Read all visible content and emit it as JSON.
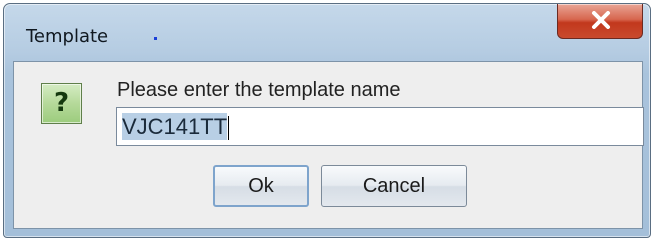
{
  "window": {
    "title": "Template"
  },
  "titlebar": {
    "close_icon": "close-x-icon"
  },
  "dialog": {
    "icon": "question-icon",
    "icon_glyph": "?",
    "prompt": "Please enter the template name",
    "input_value": "VJC141TT",
    "buttons": {
      "ok_label": "Ok",
      "cancel_label": "Cancel"
    }
  },
  "colors": {
    "close_button": "#c94a2e",
    "question_icon": "#9ccc7d",
    "selection": "#b8cfe5"
  }
}
